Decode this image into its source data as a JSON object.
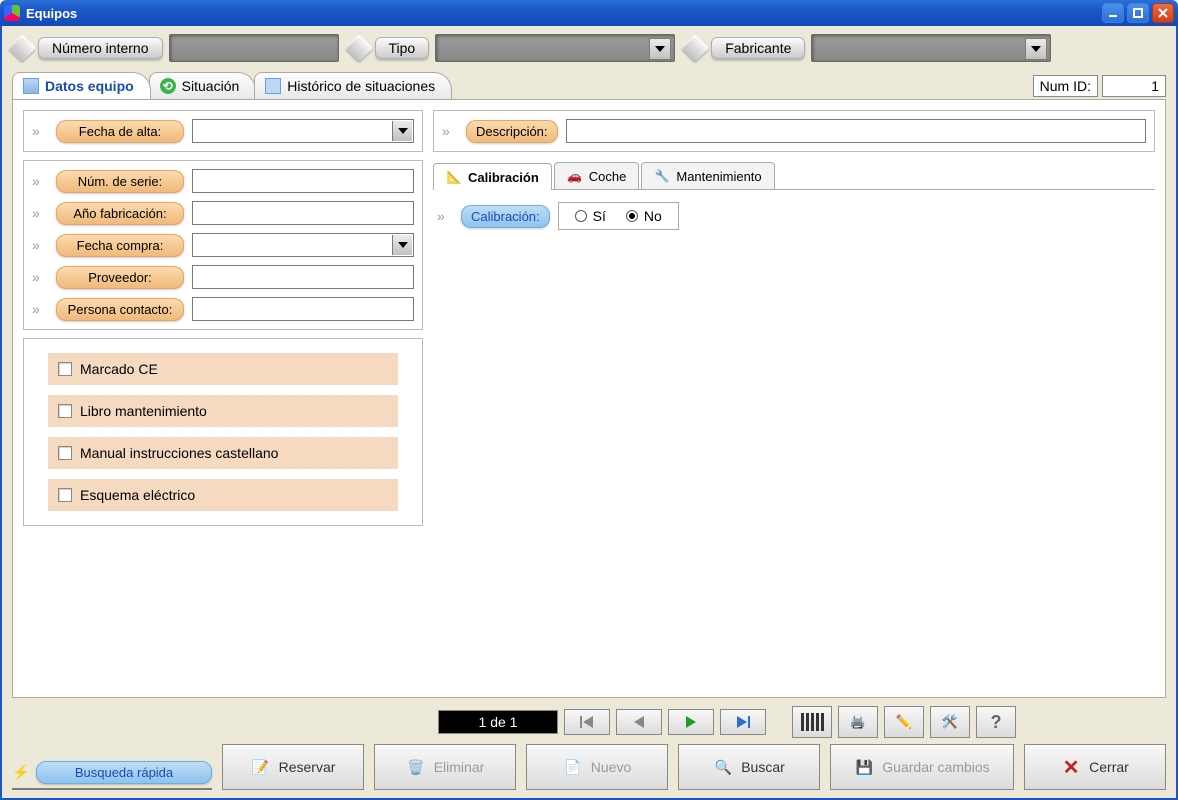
{
  "window": {
    "title": "Equipos"
  },
  "topbar": {
    "numero_interno": "Número interno",
    "tipo": "Tipo",
    "fabricante": "Fabricante"
  },
  "tabs": {
    "datos": "Datos equipo",
    "situacion": "Situación",
    "historico": "Histórico de situaciones"
  },
  "numid": {
    "label": "Num ID:",
    "value": "1"
  },
  "left": {
    "fecha_alta": "Fecha de alta:",
    "num_serie": "Núm. de serie:",
    "ano_fab": "Año fabricación:",
    "fecha_compra": "Fecha compra:",
    "proveedor": "Proveedor:",
    "persona": "Persona contacto:"
  },
  "checks": {
    "ce": "Marcado CE",
    "libro": "Libro mantenimiento",
    "manual": "Manual instrucciones castellano",
    "esquema": "Esquema eléctrico"
  },
  "right": {
    "descripcion": "Descripción:",
    "tab_cal": "Calibración",
    "tab_coche": "Coche",
    "tab_mant": "Mantenimiento",
    "calibracion": "Calibración:",
    "si": "Sí",
    "no": "No"
  },
  "pager": {
    "label": "1 de 1"
  },
  "footer": {
    "busqueda": "Busqueda rápida",
    "reservar": "Reservar",
    "eliminar": "Eliminar",
    "nuevo": "Nuevo",
    "buscar": "Buscar",
    "guardar": "Guardar cambios",
    "cerrar": "Cerrar"
  }
}
